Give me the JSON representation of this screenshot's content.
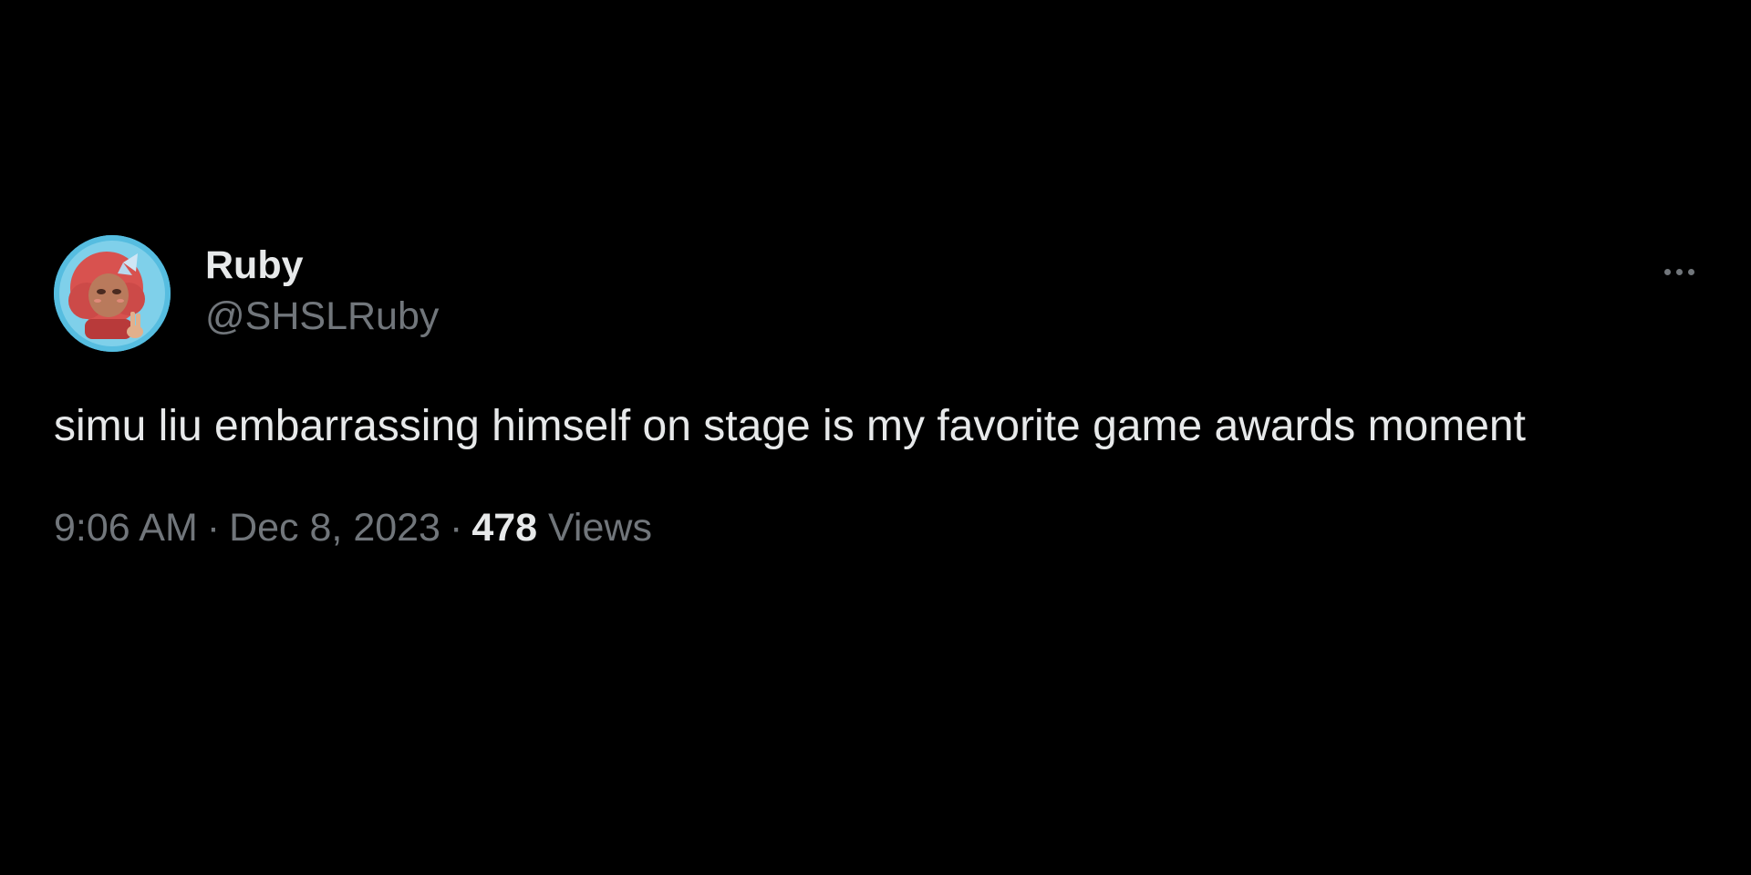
{
  "tweet": {
    "author": {
      "display_name": "Ruby",
      "handle": "@SHSLRuby",
      "avatar_icon": "avatar-illustration-icon"
    },
    "more_icon": "more-dots-icon",
    "text": "simu liu embarrassing himself on stage is my favorite game awards moment",
    "time": "9:06 AM",
    "separator": "·",
    "date": "Dec 8, 2023",
    "views_count": "478",
    "views_label": "Views"
  },
  "colors": {
    "background": "#000000",
    "primary_text": "#e7e9ea",
    "secondary_text": "#71767b",
    "avatar_ring": "#4fb6d9"
  }
}
